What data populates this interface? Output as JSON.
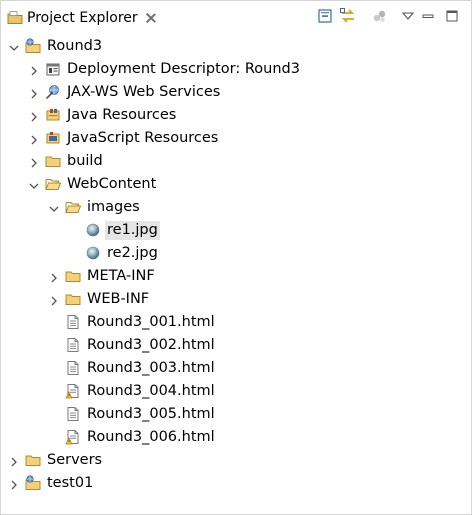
{
  "view": {
    "title": "Project Explorer",
    "tools": [
      "collapse-all-icon",
      "link-with-editor-icon",
      "filter-icon",
      "view-menu-icon",
      "minimize-icon",
      "maximize-icon"
    ]
  },
  "tree": [
    {
      "label": "Round3",
      "depth": 0,
      "expanded": true,
      "icon": "web-project-icon"
    },
    {
      "label": "Deployment Descriptor: Round3",
      "depth": 1,
      "expanded": false,
      "icon": "deployment-descriptor-icon"
    },
    {
      "label": "JAX-WS Web Services",
      "depth": 1,
      "expanded": false,
      "icon": "web-services-icon"
    },
    {
      "label": "Java Resources",
      "depth": 1,
      "expanded": false,
      "icon": "java-resources-icon"
    },
    {
      "label": "JavaScript Resources",
      "depth": 1,
      "expanded": false,
      "icon": "javascript-resources-icon"
    },
    {
      "label": "build",
      "depth": 1,
      "expanded": false,
      "icon": "folder-icon"
    },
    {
      "label": "WebContent",
      "depth": 1,
      "expanded": true,
      "icon": "folder-open-icon"
    },
    {
      "label": "images",
      "depth": 2,
      "expanded": true,
      "icon": "folder-open-icon"
    },
    {
      "label": "re1.jpg",
      "depth": 3,
      "leaf": true,
      "selected": true,
      "icon": "image-file-icon"
    },
    {
      "label": "re2.jpg",
      "depth": 3,
      "leaf": true,
      "icon": "image-file-icon"
    },
    {
      "label": "META-INF",
      "depth": 2,
      "expanded": false,
      "icon": "folder-icon"
    },
    {
      "label": "WEB-INF",
      "depth": 2,
      "expanded": false,
      "icon": "folder-icon"
    },
    {
      "label": "Round3_001.html",
      "depth": 2,
      "leaf": true,
      "icon": "html-file-icon"
    },
    {
      "label": "Round3_002.html",
      "depth": 2,
      "leaf": true,
      "icon": "html-file-icon"
    },
    {
      "label": "Round3_003.html",
      "depth": 2,
      "leaf": true,
      "icon": "html-file-icon"
    },
    {
      "label": "Round3_004.html",
      "depth": 2,
      "leaf": true,
      "icon": "html-file-warning-icon"
    },
    {
      "label": "Round3_005.html",
      "depth": 2,
      "leaf": true,
      "icon": "html-file-icon"
    },
    {
      "label": "Round3_006.html",
      "depth": 2,
      "leaf": true,
      "icon": "html-file-warning-icon"
    },
    {
      "label": "Servers",
      "depth": 0,
      "expanded": false,
      "icon": "folder-icon"
    },
    {
      "label": "test01",
      "depth": 0,
      "expanded": false,
      "icon": "web-project-icon"
    }
  ]
}
